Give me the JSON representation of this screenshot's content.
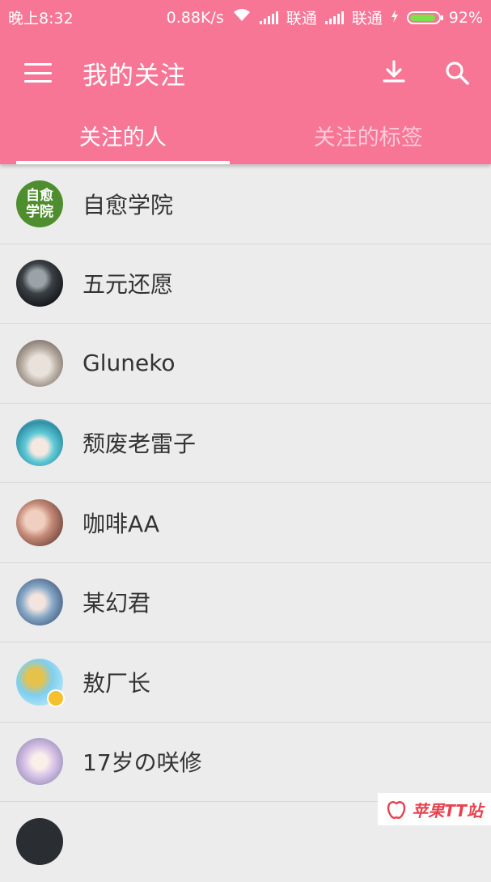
{
  "status_bar": {
    "time": "晚上8:32",
    "speed": "0.88K/s",
    "carrier1": "联通",
    "carrier2": "联通",
    "battery": "92%",
    "battery_level": 0.92
  },
  "app_bar": {
    "title": "我的关注",
    "icons": [
      "menu-icon",
      "download-icon",
      "search-icon"
    ]
  },
  "tabs": [
    {
      "label": "关注的人",
      "active": true
    },
    {
      "label": "关注的标签",
      "active": false
    }
  ],
  "following": [
    {
      "name": "自愈学院",
      "avatar_text": [
        "自愈",
        "学院"
      ],
      "avatar_color": "#4f8e2f"
    },
    {
      "name": "五元还愿",
      "avatar_color": "#2b2f33"
    },
    {
      "name": "Gluneko",
      "avatar_color": "#a79c92"
    },
    {
      "name": "颓废老雷子",
      "avatar_color": "#63c6d2"
    },
    {
      "name": "咖啡AA",
      "avatar_color": "#b98373"
    },
    {
      "name": "某幻君",
      "avatar_color": "#8fb0cf"
    },
    {
      "name": "敖厂长",
      "avatar_color": "#7ecff0",
      "badge": true
    },
    {
      "name": "17岁の咲修",
      "avatar_color": "#dcc8ea"
    }
  ],
  "watermark": "苹果TT站"
}
